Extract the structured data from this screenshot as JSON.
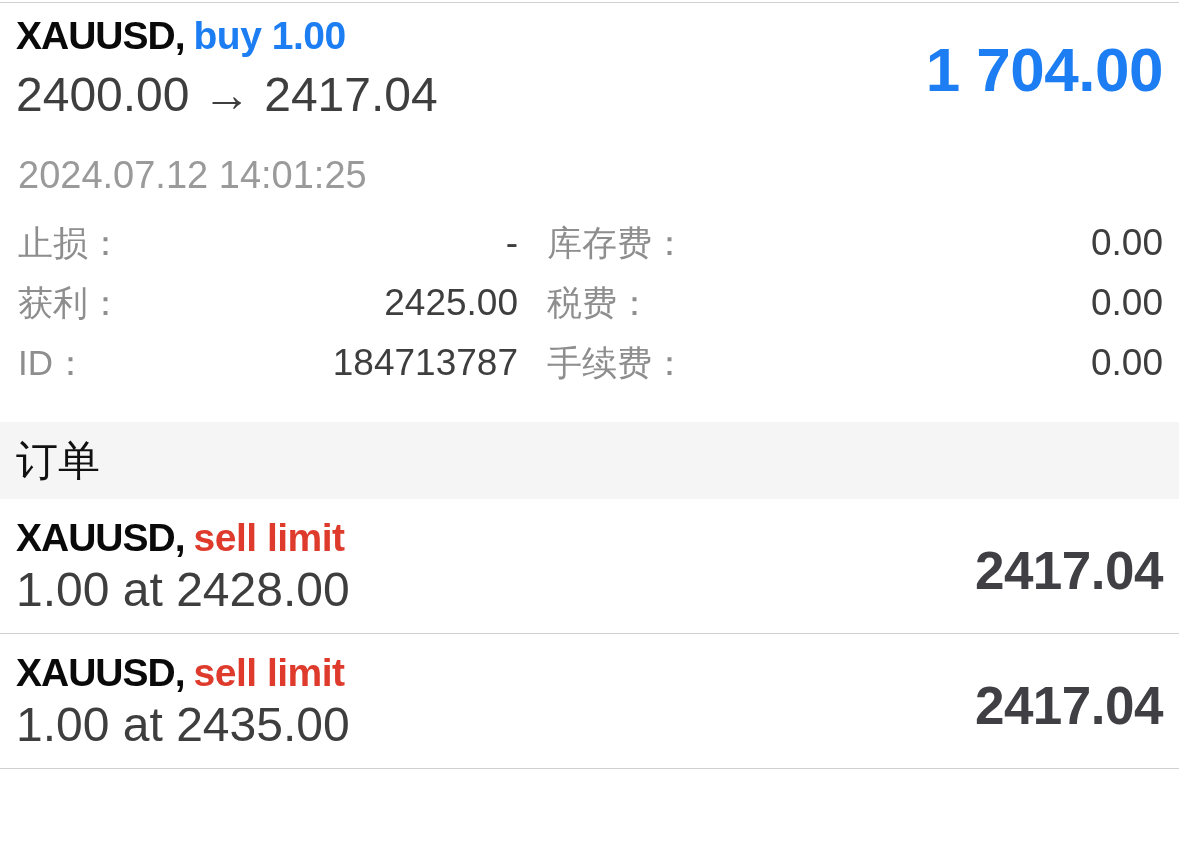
{
  "position": {
    "symbol": "XAUUSD,",
    "side": "buy",
    "volume": "1.00",
    "prices": "2400.00 → 2417.04",
    "profit": "1 704.00",
    "time": "2024.07.12 14:01:25",
    "detail_rows": [
      [
        {
          "label": "止损：",
          "value": "-"
        },
        {
          "label": "库存费：",
          "value": "0.00"
        }
      ],
      [
        {
          "label": "获利：",
          "value": "2425.00"
        },
        {
          "label": "税费：",
          "value": "0.00"
        }
      ],
      [
        {
          "label": "ID：",
          "value": "184713787"
        },
        {
          "label": "手续费：",
          "value": "0.00"
        }
      ]
    ]
  },
  "orders_section": {
    "title": "订单"
  },
  "orders": [
    {
      "symbol": "XAUUSD,",
      "side": "sell",
      "order_kind": "limit",
      "volume_price": "1.00 at 2428.00",
      "current_price": "2417.04"
    },
    {
      "symbol": "XAUUSD,",
      "side": "sell",
      "order_kind": "limit",
      "volume_price": "1.00 at 2435.00",
      "current_price": "2417.04"
    }
  ]
}
